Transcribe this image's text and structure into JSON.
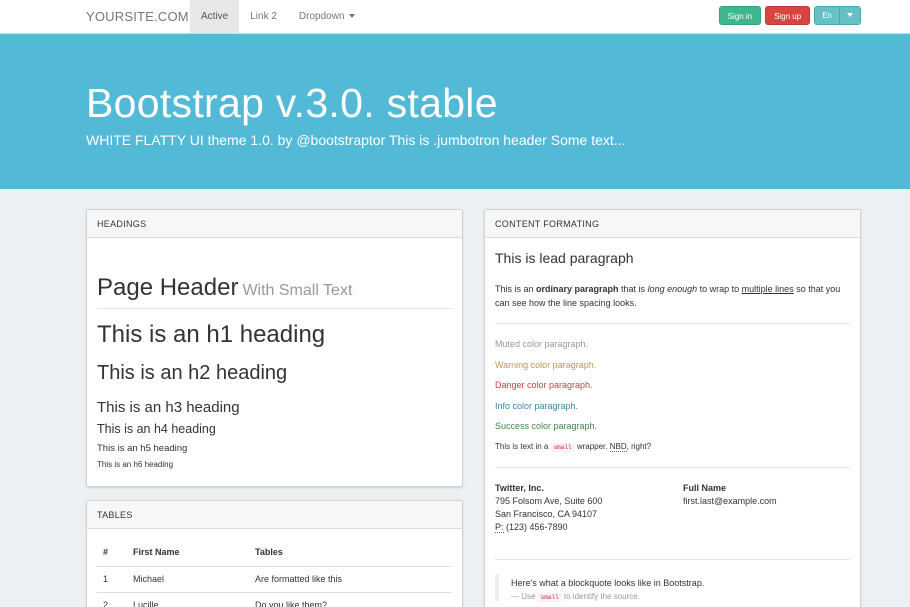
{
  "navbar": {
    "brand": "YOURSITE.COM",
    "links": [
      "Active",
      "Link 2",
      "Dropdown"
    ],
    "signin_label": "Sign in",
    "signup_label": "Sign up",
    "lang_label": "En"
  },
  "jumbotron": {
    "title": "Bootstrap v.3.0. stable",
    "subtitle": "WHITE FLATTY UI theme 1.0. by @bootstraptor This is .jumbotron header Some text..."
  },
  "headings_panel": {
    "title": "HEADINGS",
    "page_header": "Page Header",
    "page_header_small": "With Small Text",
    "h1": "This is an h1 heading",
    "h2": "This is an h2 heading",
    "h3": "This is an h3 heading",
    "h4": "This is an h4 heading",
    "h5": "This is an h5 heading",
    "h6": "This is an h6 heading"
  },
  "tables_panel": {
    "title": "TABLES",
    "columns": [
      "#",
      "First Name",
      "Tables"
    ],
    "rows": [
      [
        "1",
        "Michael",
        "Are formatted like this"
      ],
      [
        "2",
        "Lucille",
        "Do you like them?"
      ]
    ]
  },
  "content_panel": {
    "title": "CONTENT FORMATING",
    "lead": "This is lead paragraph",
    "para_1": "This is an ",
    "para_bold": "ordinary paragraph",
    "para_2": " that is ",
    "para_italic": "long enough",
    "para_3": " to wrap to ",
    "para_underline": "multiple lines",
    "para_4": " so that you can see how the line spacing looks.",
    "muted": "Muted color paragraph.",
    "warning": "Warning color paragraph.",
    "danger": "Danger color paragraph.",
    "info": "Info color paragraph.",
    "success": "Success color paragraph.",
    "small_1": "This is text in a ",
    "small_code": "small",
    "small_2": " wrapper. ",
    "small_abbr": "NBD",
    "small_3": ", right?",
    "address_company": "Twitter, Inc.",
    "address_street": "795 Folsom Ave, Suite 600",
    "address_city": "San Francisco, CA 94107",
    "address_phone_label": "P:",
    "address_phone": " (123) 456-7890",
    "fullname_label": "Full Name",
    "email": "first.last@example.com",
    "blockquote": "Here's what a blockquote looks like in Bootstrap.",
    "bq_src_1": "— Use ",
    "bq_src_code": "small",
    "bq_src_2": " to identify the source."
  },
  "colors": {
    "jumbotron_bg": "#52bad6",
    "signin": "#3fb68e",
    "signup": "#d64541",
    "lang": "#67c0c6",
    "muted": "#999999",
    "warning": "#c09853",
    "danger": "#b94a48",
    "info": "#3a87ad",
    "success": "#468847"
  }
}
